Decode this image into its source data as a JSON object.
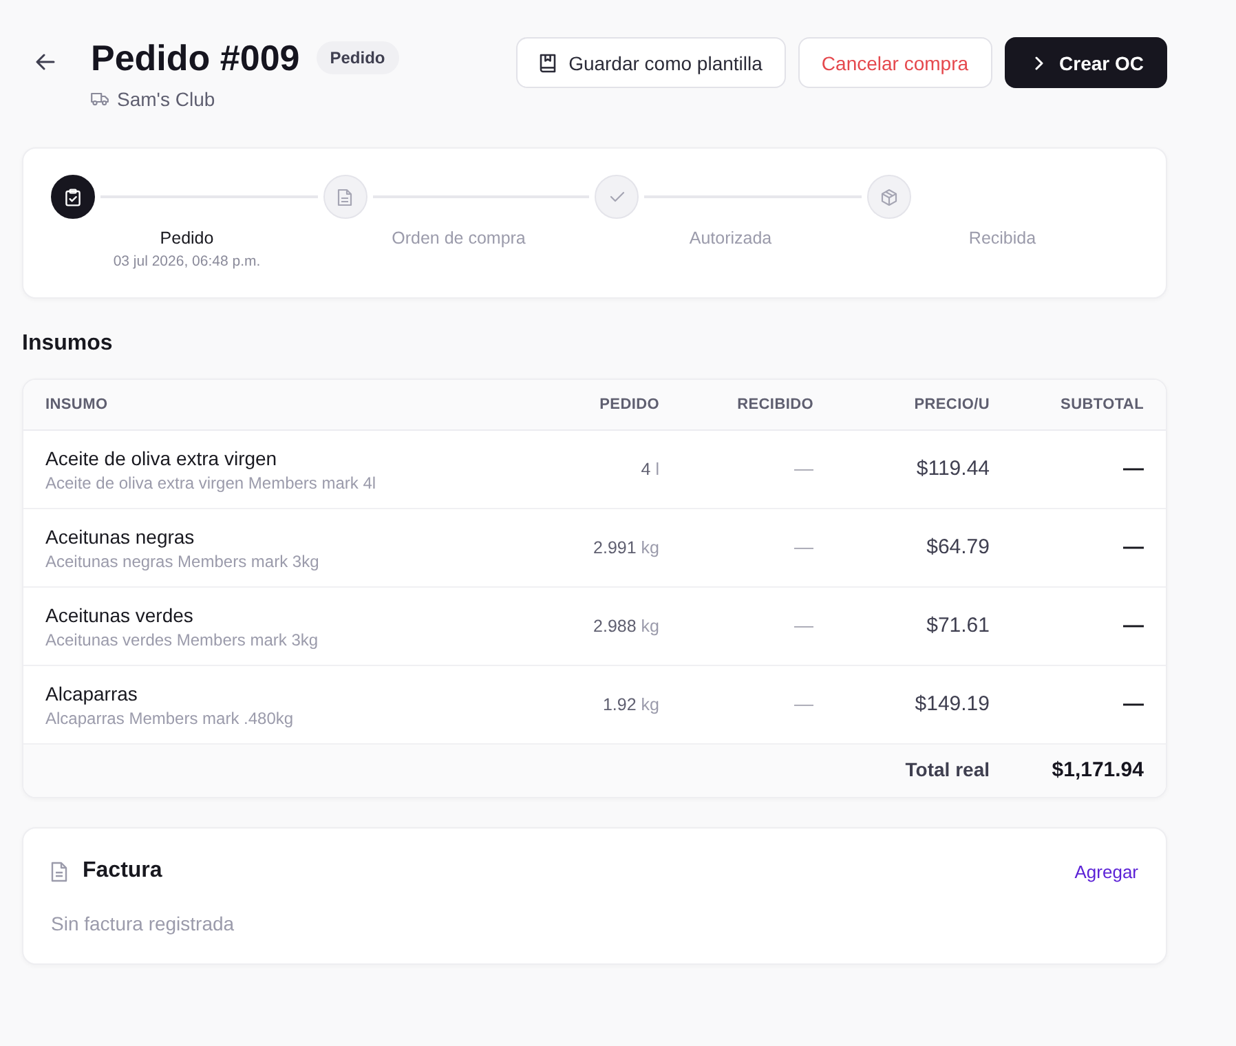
{
  "header": {
    "title": "Pedido #009",
    "status": "Pedido",
    "supplier": "Sam's Club"
  },
  "actions": [
    {
      "kind": "outline",
      "label": "Guardar como plantilla"
    },
    {
      "kind": "danger",
      "label": "Cancelar compra"
    },
    {
      "kind": "primary",
      "label": "Crear OC"
    }
  ],
  "steps": [
    {
      "label": "Pedido",
      "date": "03 jul 2026, 06:48 p.m.",
      "active": true
    },
    {
      "label": "Orden de compra",
      "active": false
    },
    {
      "label": "Autorizada",
      "active": false
    },
    {
      "label": "Recibida",
      "active": false
    }
  ],
  "section_title": "Insumos",
  "table": {
    "columns": [
      "INSUMO",
      "PEDIDO",
      "RECIBIDO",
      "PRECIO/U",
      "SUBTOTAL"
    ],
    "rows": [
      {
        "name": "Aceite de oliva extra virgen",
        "description": "Aceite de oliva extra virgen Members mark 4l",
        "ordered": {
          "amount": "4",
          "unit": "l"
        },
        "received": "—",
        "unit_price": "$119.44",
        "subtotal": "—"
      },
      {
        "name": "Aceitunas negras",
        "description": "Aceitunas negras Members mark 3kg",
        "ordered": {
          "amount": "2.991",
          "unit": "kg"
        },
        "received": "—",
        "unit_price": "$64.79",
        "subtotal": "—"
      },
      {
        "name": "Aceitunas verdes",
        "description": "Aceitunas verdes Members mark 3kg",
        "ordered": {
          "amount": "2.988",
          "unit": "kg"
        },
        "received": "—",
        "unit_price": "$71.61",
        "subtotal": "—"
      },
      {
        "name": "Alcaparras",
        "description": "Alcaparras Members mark .480kg",
        "ordered": {
          "amount": "1.92",
          "unit": "kg"
        },
        "received": "—",
        "unit_price": "$149.19",
        "subtotal": "—"
      }
    ],
    "footer": {
      "label": "Total real",
      "value": "$1,171.94"
    }
  },
  "invoice": {
    "title": "Factura",
    "action": "Agregar",
    "empty_text": "Sin factura registrada"
  }
}
